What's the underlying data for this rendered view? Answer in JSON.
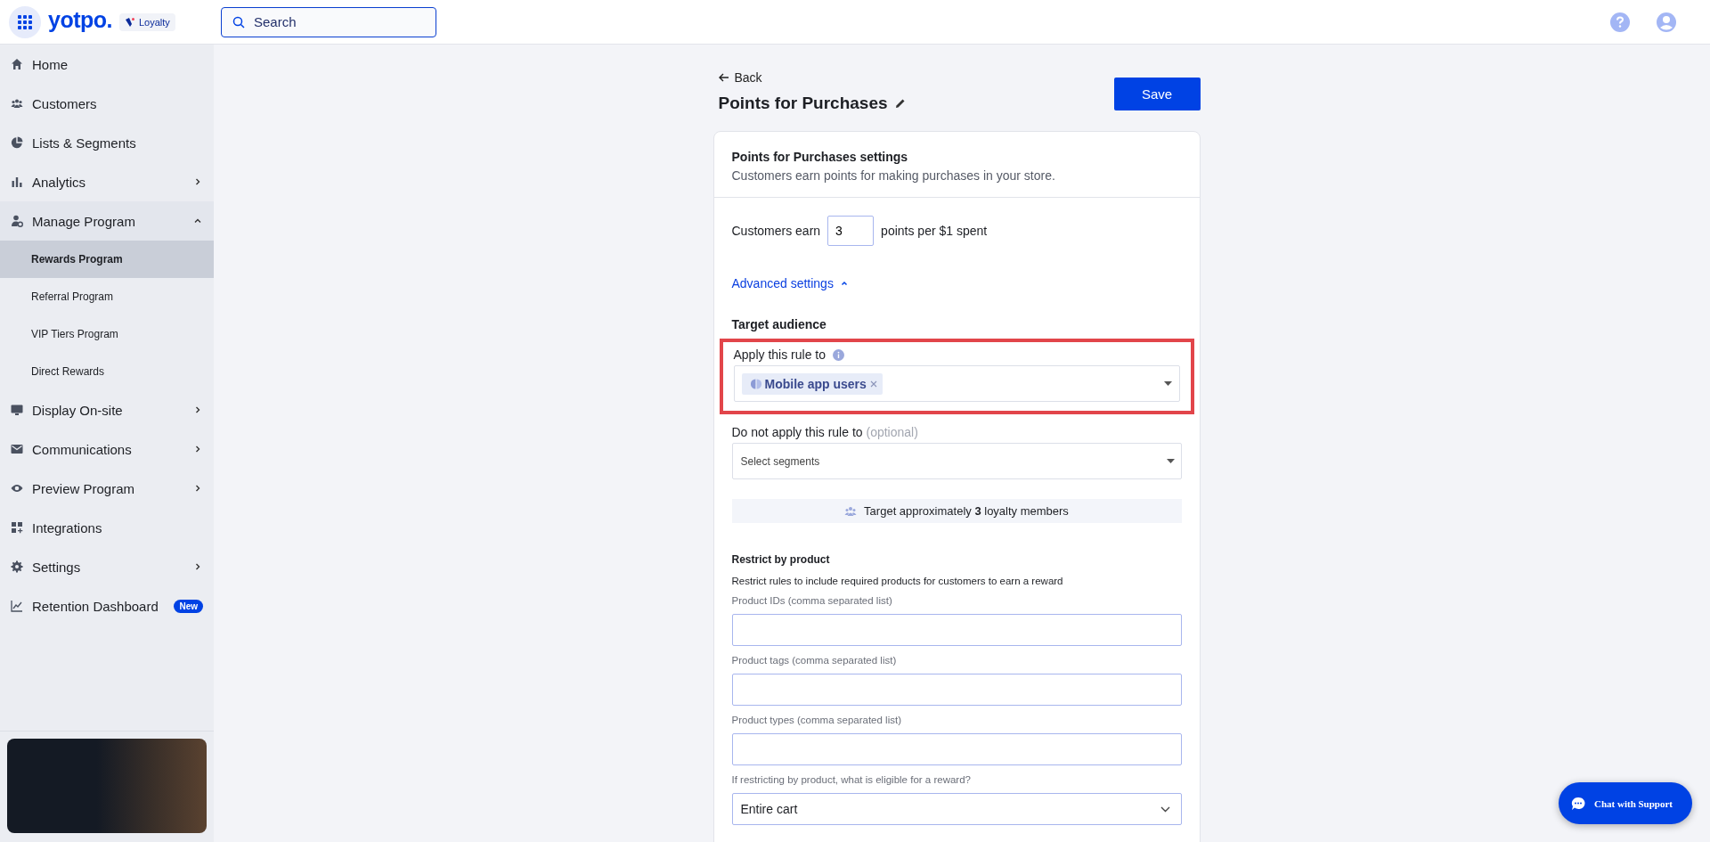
{
  "header": {
    "brand": "yotpo.",
    "product_badge": "Loyalty",
    "search": {
      "placeholder": "Search"
    }
  },
  "sidebar": {
    "items": [
      {
        "label": "Home",
        "selected": false
      },
      {
        "label": "Customers",
        "selected": false
      },
      {
        "label": "Lists & Segments",
        "selected": false
      },
      {
        "label": "Analytics",
        "selected": false,
        "expanded": false
      },
      {
        "label": "Manage Program",
        "selected": false,
        "expanded": true,
        "children": [
          {
            "label": "Rewards Program",
            "selected": true
          },
          {
            "label": "Referral Program",
            "selected": false
          },
          {
            "label": "VIP Tiers Program",
            "selected": false
          },
          {
            "label": "Direct Rewards",
            "selected": false
          }
        ]
      },
      {
        "label": "Display On-site",
        "selected": false,
        "expanded": false
      },
      {
        "label": "Communications",
        "selected": false,
        "expanded": false
      },
      {
        "label": "Preview Program",
        "selected": false,
        "expanded": false
      },
      {
        "label": "Integrations",
        "selected": false
      },
      {
        "label": "Settings",
        "selected": false,
        "expanded": false
      },
      {
        "label": "Retention Dashboard",
        "selected": false,
        "badge": "New"
      }
    ]
  },
  "page": {
    "back": "Back",
    "title": "Points for Purchases",
    "save": "Save"
  },
  "card": {
    "title": "Points for Purchases settings",
    "subtitle": "Customers earn points for making purchases in your store.",
    "earn": {
      "prefix": "Customers earn",
      "value": "3",
      "suffix": "points per $1 spent"
    },
    "advanced": {
      "label": "Advanced settings",
      "expanded": true
    },
    "target": {
      "heading": "Target audience",
      "apply": {
        "label": "Apply this rule to",
        "highlighted": true,
        "tags": [
          "Mobile app users"
        ]
      },
      "exclude": {
        "label": "Do not apply this rule to",
        "hint": "(optional)",
        "placeholder": "Select segments"
      },
      "estimate": "Target approximately **3** loyalty members"
    },
    "restrict_product": {
      "heading": "Restrict by product",
      "description": "Restrict rules to include required products for customers to earn a reward",
      "fields": [
        {
          "label": "Product IDs (comma separated list)"
        },
        {
          "label": "Product tags (comma separated list)"
        },
        {
          "label": "Product types (comma separated list)"
        }
      ],
      "eligible": {
        "label": "If restricting by product, what is eligible for a reward?",
        "value": "Entire cart"
      }
    }
  },
  "chat_button": "Chat with Support"
}
